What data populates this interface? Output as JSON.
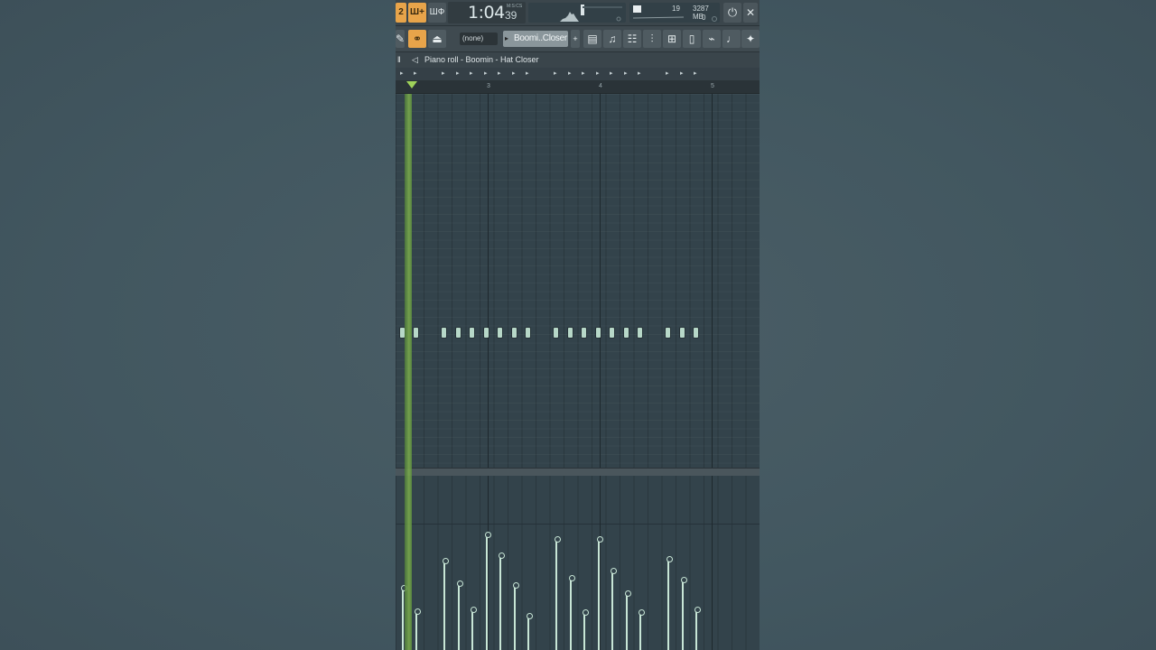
{
  "transport": {
    "pattern_num": "2",
    "btn2": "Ш+",
    "btn3": "ШФ",
    "time_main": "1:04",
    "time_small": "39",
    "time_label": "M:S:CS",
    "cpu_value": "19",
    "memory": "3287 MB",
    "polyphony": "0"
  },
  "toolbar": {
    "snap_value": "(none)",
    "channel_name": "Boomi..Closer"
  },
  "piano_roll": {
    "title": "Piano roll - Boomin - Hat Closer",
    "bar_numbers": [
      "3",
      "4",
      "5"
    ],
    "bar_positions": [
      101.5,
      226,
      350
    ],
    "note_x": [
      7,
      22,
      53,
      69,
      84,
      100,
      115,
      131,
      146,
      177,
      193,
      208,
      224,
      239,
      255,
      270,
      301,
      317,
      332
    ],
    "velocities": [
      0.35,
      0.22,
      0.51,
      0.38,
      0.23,
      0.66,
      0.54,
      0.37,
      0.19,
      0.63,
      0.41,
      0.21,
      0.63,
      0.45,
      0.32,
      0.21,
      0.52,
      0.4,
      0.23
    ]
  },
  "colors": {
    "accent": "#e8a44a",
    "playhead": "#7fb04e",
    "note": "#b7d8c8"
  }
}
